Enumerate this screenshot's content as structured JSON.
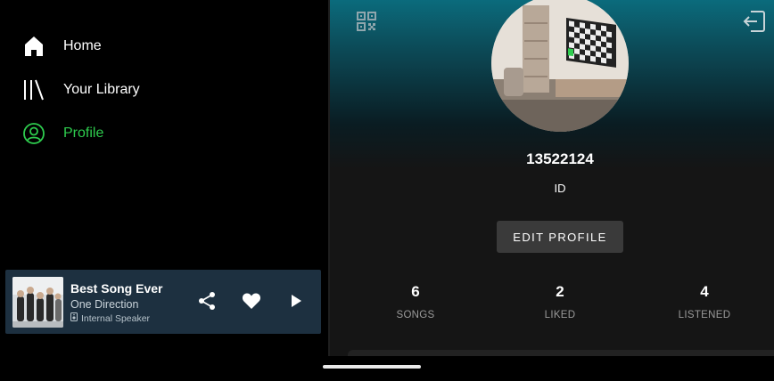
{
  "sidebar": {
    "items": [
      {
        "label": "Home",
        "icon": "home-icon",
        "active": false
      },
      {
        "label": "Your Library",
        "icon": "library-icon",
        "active": false
      },
      {
        "label": "Profile",
        "icon": "profile-icon",
        "active": true
      }
    ]
  },
  "player": {
    "title": "Best Song Ever",
    "artist": "One Direction",
    "device": "Internal Speaker",
    "icons": [
      "share-icon",
      "heart-icon",
      "play-icon"
    ]
  },
  "profile": {
    "username": "13522124",
    "id_label": "ID",
    "edit_button": "EDIT PROFILE",
    "stats": [
      {
        "value": "6",
        "label": "SONGS"
      },
      {
        "value": "2",
        "label": "LIKED"
      },
      {
        "value": "4",
        "label": "LISTENED"
      }
    ]
  },
  "colors": {
    "accent": "#2ecc4e",
    "player_bg": "#1d3040",
    "header_gradient_top": "#0b6b7c",
    "profile_bg": "#151515"
  }
}
